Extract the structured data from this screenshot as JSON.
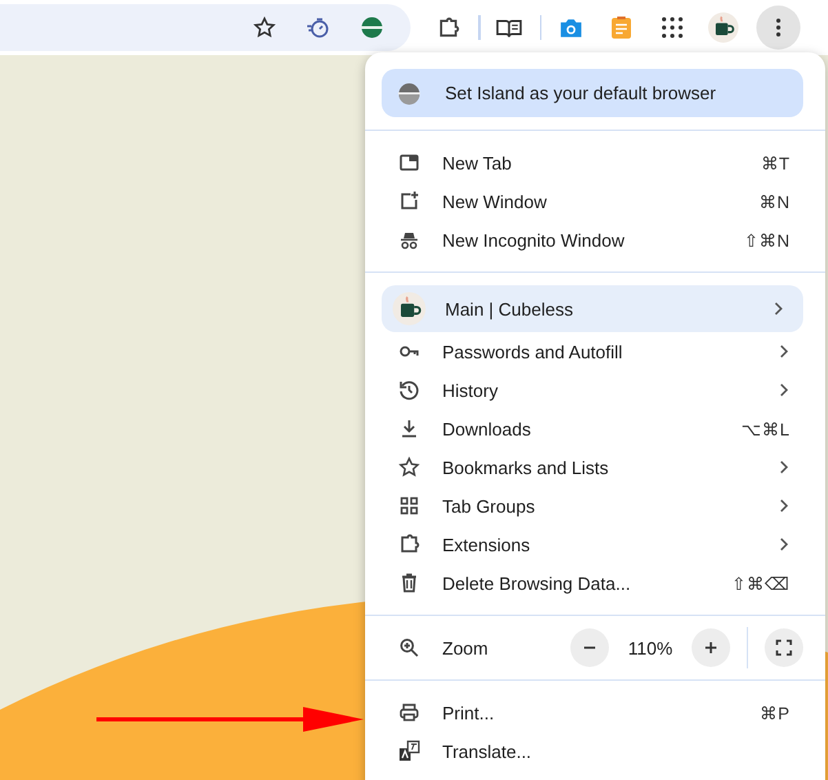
{
  "menu": {
    "banner": "Set Island as your default browser",
    "groups": [
      [
        {
          "kind": "item",
          "label": "New Tab",
          "shortcut": "⌘T",
          "submenu": false
        },
        {
          "kind": "item",
          "label": "New Window",
          "shortcut": "⌘N",
          "submenu": false
        },
        {
          "kind": "item",
          "label": "New Incognito Window",
          "shortcut": "⇧⌘N",
          "submenu": false
        }
      ],
      [
        {
          "kind": "profile",
          "label": "Main | Cubeless",
          "submenu": true
        },
        {
          "kind": "item",
          "label": "Passwords and Autofill",
          "submenu": true
        },
        {
          "kind": "item",
          "label": "History",
          "submenu": true
        },
        {
          "kind": "item",
          "label": "Downloads",
          "shortcut": "⌥⌘L",
          "submenu": false
        },
        {
          "kind": "item",
          "label": "Bookmarks and Lists",
          "submenu": true
        },
        {
          "kind": "item",
          "label": "Tab Groups",
          "submenu": true
        },
        {
          "kind": "item",
          "label": "Extensions",
          "submenu": true
        },
        {
          "kind": "item",
          "label": "Delete Browsing Data...",
          "shortcut": "⇧⌘⌫",
          "submenu": false
        }
      ],
      [
        {
          "kind": "zoom",
          "label": "Zoom",
          "value": "110%"
        }
      ],
      [
        {
          "kind": "item",
          "label": "Print...",
          "shortcut": "⌘P",
          "submenu": false
        },
        {
          "kind": "item",
          "label": "Translate...",
          "submenu": false
        }
      ]
    ]
  }
}
